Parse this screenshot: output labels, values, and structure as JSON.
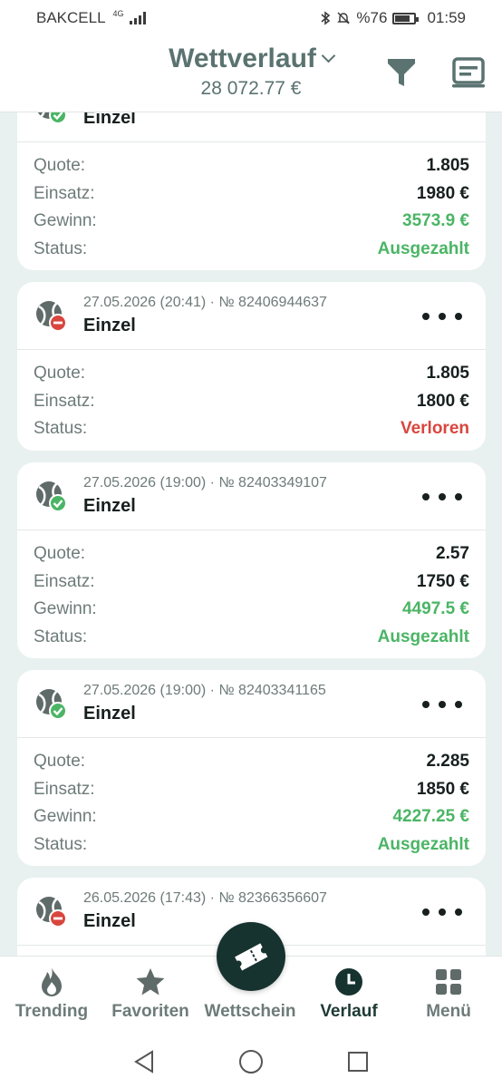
{
  "status_bar": {
    "carrier": "BAKCELL",
    "network": "4G",
    "battery": "%76",
    "time": "01:59"
  },
  "header": {
    "title": "Wettverlauf",
    "balance": "28 072.77 €"
  },
  "labels": {
    "odds": "Quote:",
    "stake": "Einsatz:",
    "win": "Gewinn:",
    "status": "Status:"
  },
  "bets": [
    {
      "meta": "",
      "type": "Einzel",
      "result": "won",
      "odds": "1.805",
      "stake": "1980 €",
      "win": "3573.9 €",
      "status": "Ausgezahlt"
    },
    {
      "meta": "27.05.2026 (20:41) · № 82406944637",
      "type": "Einzel",
      "result": "lost",
      "odds": "1.805",
      "stake": "1800 €",
      "status": "Verloren"
    },
    {
      "meta": "27.05.2026 (19:00) · № 82403349107",
      "type": "Einzel",
      "result": "won",
      "odds": "2.57",
      "stake": "1750 €",
      "win": "4497.5 €",
      "status": "Ausgezahlt"
    },
    {
      "meta": "27.05.2026 (19:00) · № 82403341165",
      "type": "Einzel",
      "result": "won",
      "odds": "2.285",
      "stake": "1850 €",
      "win": "4227.25 €",
      "status": "Ausgezahlt"
    },
    {
      "meta": "26.05.2026 (17:43) · № 82366356607",
      "type": "Einzel",
      "result": "lost"
    }
  ],
  "nav": {
    "trending": "Trending",
    "favorites": "Favoriten",
    "betslip": "Wettschein",
    "history": "Verlauf",
    "menu": "Menü"
  },
  "colors": {
    "win": "#4bb565",
    "lose": "#d8463e",
    "dark": "#17332f",
    "muted": "#5a7370"
  }
}
